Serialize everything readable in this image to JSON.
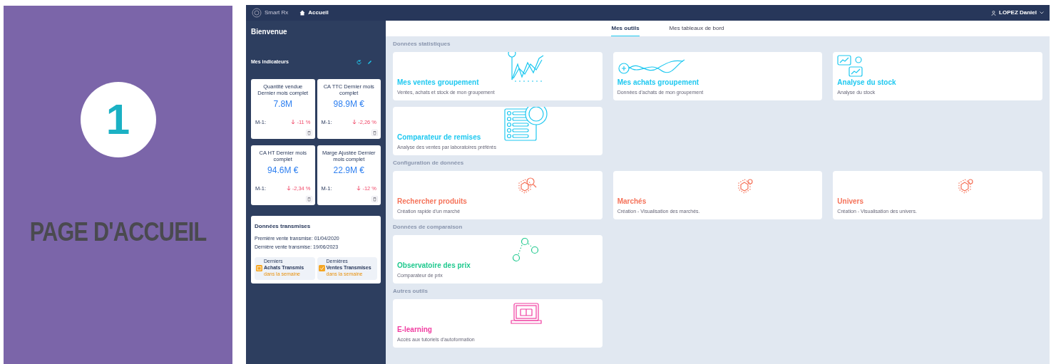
{
  "slide": {
    "step": "1",
    "title": "PAGE D'ACCUEIL"
  },
  "topbar": {
    "app_name": "Smart Rx",
    "breadcrumb": "Accueil",
    "user": "LOPEZ Daniel"
  },
  "sidebar": {
    "welcome": "Bienvenue",
    "indicators_title": "Mes indicateurs",
    "indicators": [
      {
        "title": "Quantité vendue Dernier mois complet",
        "value": "7.8M",
        "period": "M-1:",
        "change": "-11 %"
      },
      {
        "title": "CA TTC Dernier mois complet",
        "value": "98.9M €",
        "period": "M-1:",
        "change": "-2,26 %"
      },
      {
        "title": "CA HT Dernier mois complet",
        "value": "94.6M €",
        "period": "M-1:",
        "change": "-2,34 %"
      },
      {
        "title": "Marge Ajustée Dernier mois complet",
        "value": "22.9M €",
        "period": "M-1:",
        "change": "-12 %"
      }
    ],
    "transmitted": {
      "title": "Données transmises",
      "lines": [
        "Première vente transmise: 01/04/2020",
        "Dernière vente transmise: 19/06/2023"
      ],
      "items": [
        {
          "kind": "calendar",
          "caption": "Derniers",
          "label": "Achats Transmis",
          "note": "dans la semaine"
        },
        {
          "kind": "check",
          "caption": "Dernières",
          "label": "Ventes Transmises",
          "note": "dans la semaine"
        }
      ]
    }
  },
  "tabs": [
    {
      "label": "Mes outils",
      "selected": true
    },
    {
      "label": "Mes tableaux de bord",
      "selected": false
    }
  ],
  "sections": [
    {
      "title": "Données statistiques",
      "tools": [
        {
          "title": "Mes ventes groupement",
          "description": "Ventes, achats et stock de mon groupement",
          "color": "#1ec8f0",
          "kind": "chart"
        },
        {
          "title": "Mes achats groupement",
          "description": "Données d'achats de mon groupement",
          "color": "#1ec8f0",
          "kind": "wave"
        },
        {
          "title": "Analyse du stock",
          "description": "Analyse du stock",
          "color": "#1ec8f0",
          "kind": "bubbles"
        },
        {
          "title": "Comparateur de remises",
          "description": "Analyse des ventes par laboratoires préférés",
          "color": "#1ec8f0",
          "kind": "list"
        }
      ]
    },
    {
      "title": "Configuration de données",
      "tools": [
        {
          "title": "Rechercher produits",
          "description": "Création rapide d'un marché",
          "color": "#f5735a",
          "kind": "hexsearch"
        },
        {
          "title": "Marchés",
          "description": "Création - Visualisation des marchés.",
          "color": "#f5735a",
          "kind": "hex"
        },
        {
          "title": "Univers",
          "description": "Création - Visualisation des univers.",
          "color": "#f5735a",
          "kind": "hex"
        }
      ]
    },
    {
      "title": "Données de comparaison",
      "tools": [
        {
          "title": "Observatoire des prix",
          "description": "Comparateur de prix",
          "color": "#1fc98e",
          "kind": "coins"
        }
      ]
    },
    {
      "title": "Autres outils",
      "tools": [
        {
          "title": "E-learning",
          "description": "Accès aux tutoriels d'autoformation",
          "color": "#f03ca0",
          "kind": "laptop"
        }
      ]
    }
  ]
}
